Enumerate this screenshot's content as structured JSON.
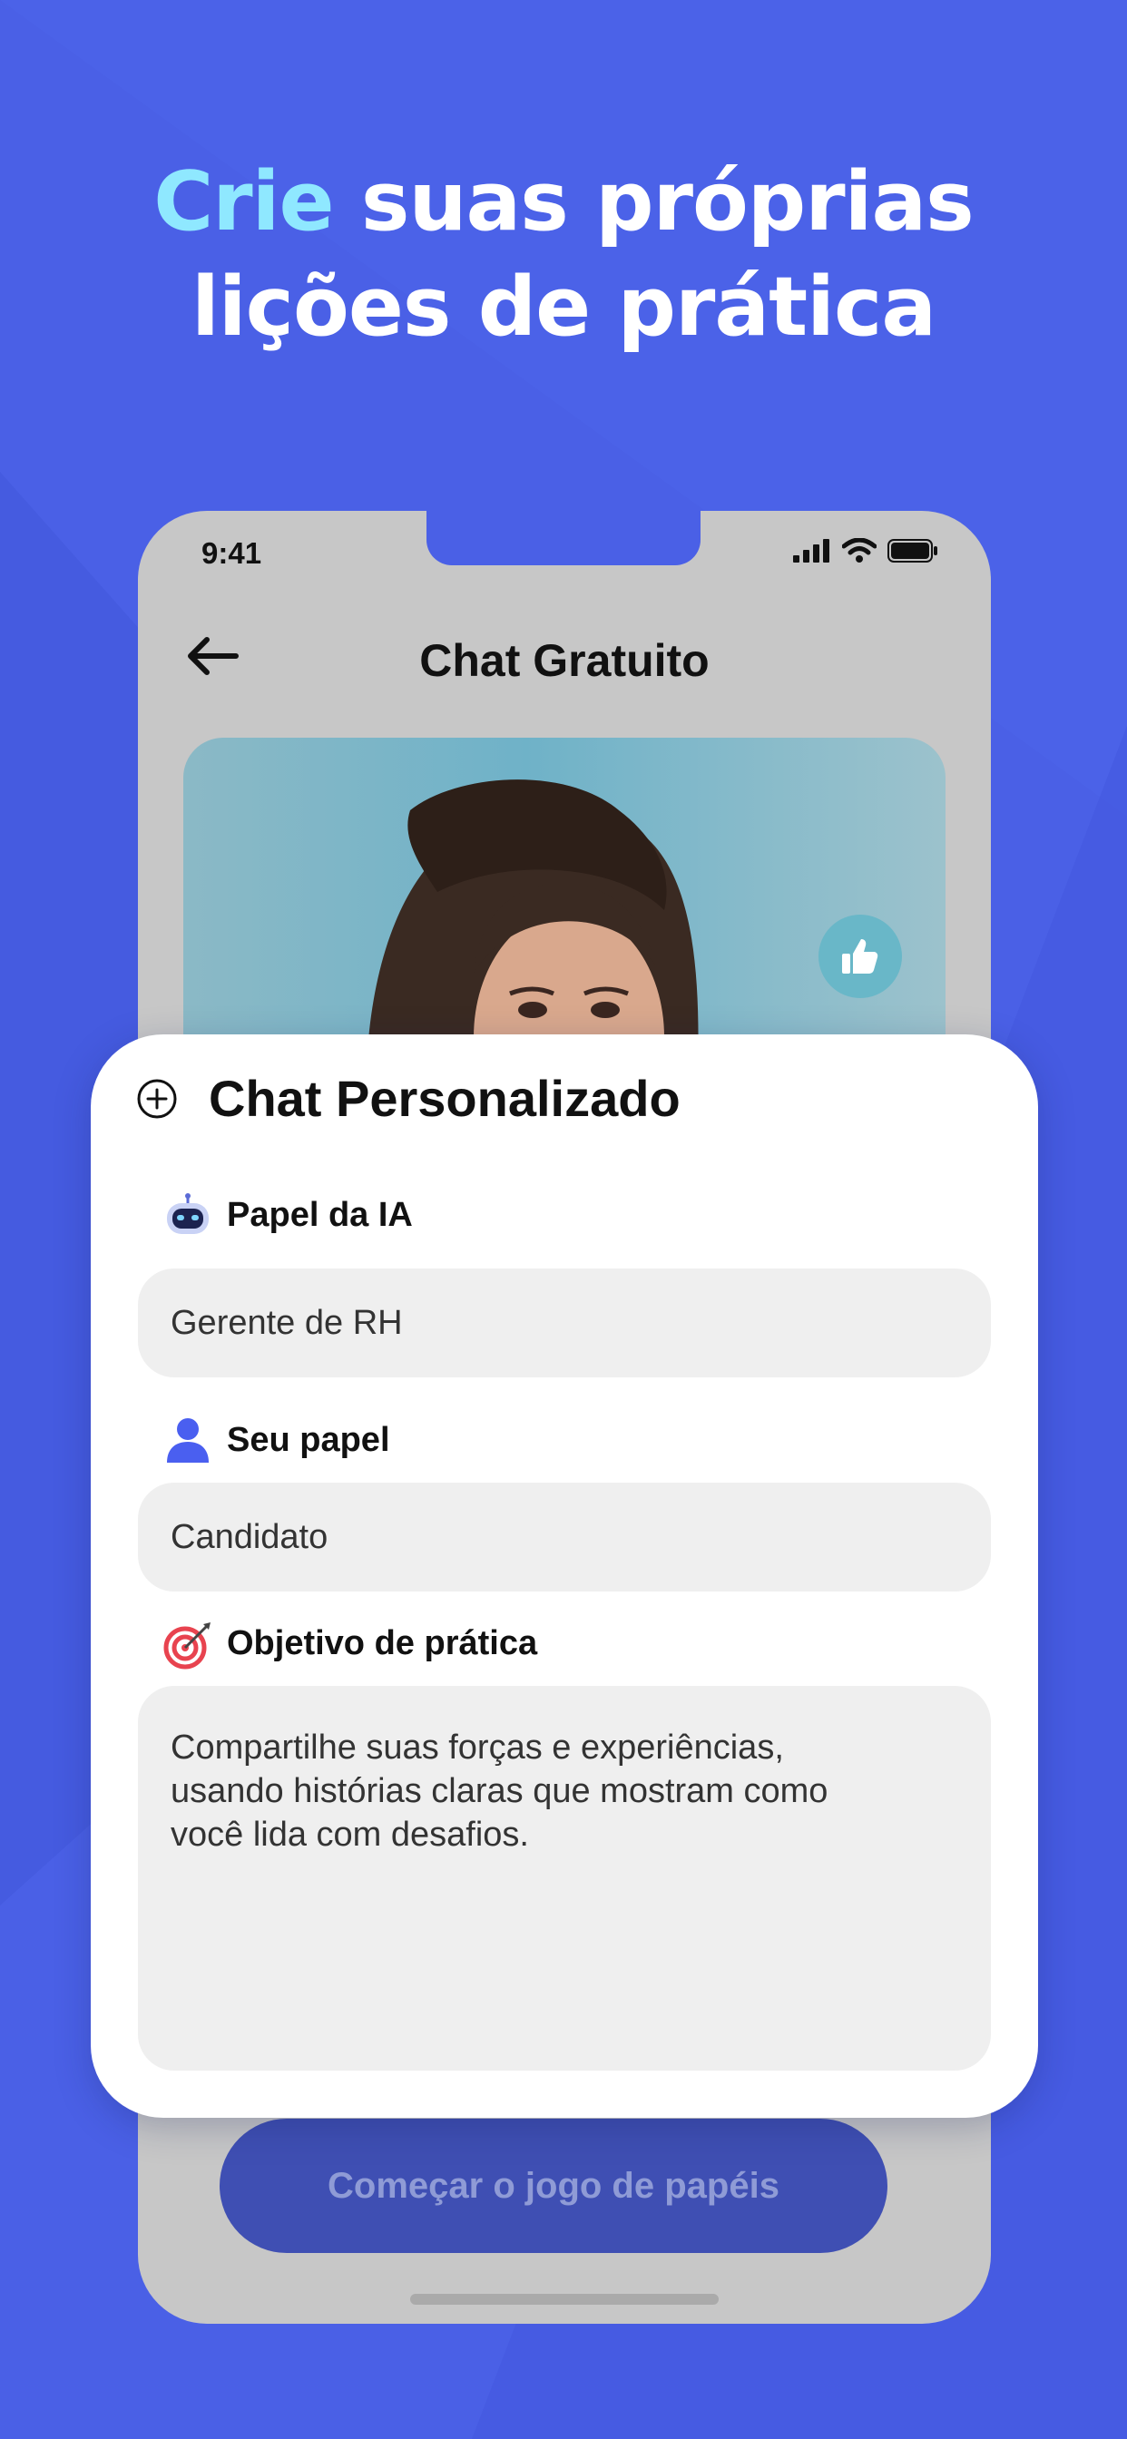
{
  "headline": {
    "accent": "Crie",
    "rest_line1": " suas próprias",
    "line2": "lições de prática"
  },
  "status_bar": {
    "time": "9:41"
  },
  "nav": {
    "title": "Chat Gratuito"
  },
  "card": {
    "title": "Chat Personalizado",
    "ai_role": {
      "label": "Papel da IA",
      "value": "Gerente de RH"
    },
    "user_role": {
      "label": "Seu papel",
      "value": "Candidato"
    },
    "goal": {
      "label": "Objetivo de prática",
      "line1": "Compartilhe suas forças e experiências,",
      "line2": "usando histórias claras que mostram como",
      "line3": "você lida com desafios."
    }
  },
  "start_button": {
    "label": "Começar o jogo de papéis"
  },
  "colors": {
    "background": "#4a60e6",
    "accent_text": "#8fe8ff",
    "button": "#3f4fb3",
    "field": "#efefef"
  },
  "icons": [
    "back-arrow-icon",
    "thumbs-up-icon",
    "plus-circle-icon",
    "robot-icon",
    "person-icon",
    "target-icon",
    "signal-icon",
    "wifi-icon",
    "battery-icon"
  ]
}
